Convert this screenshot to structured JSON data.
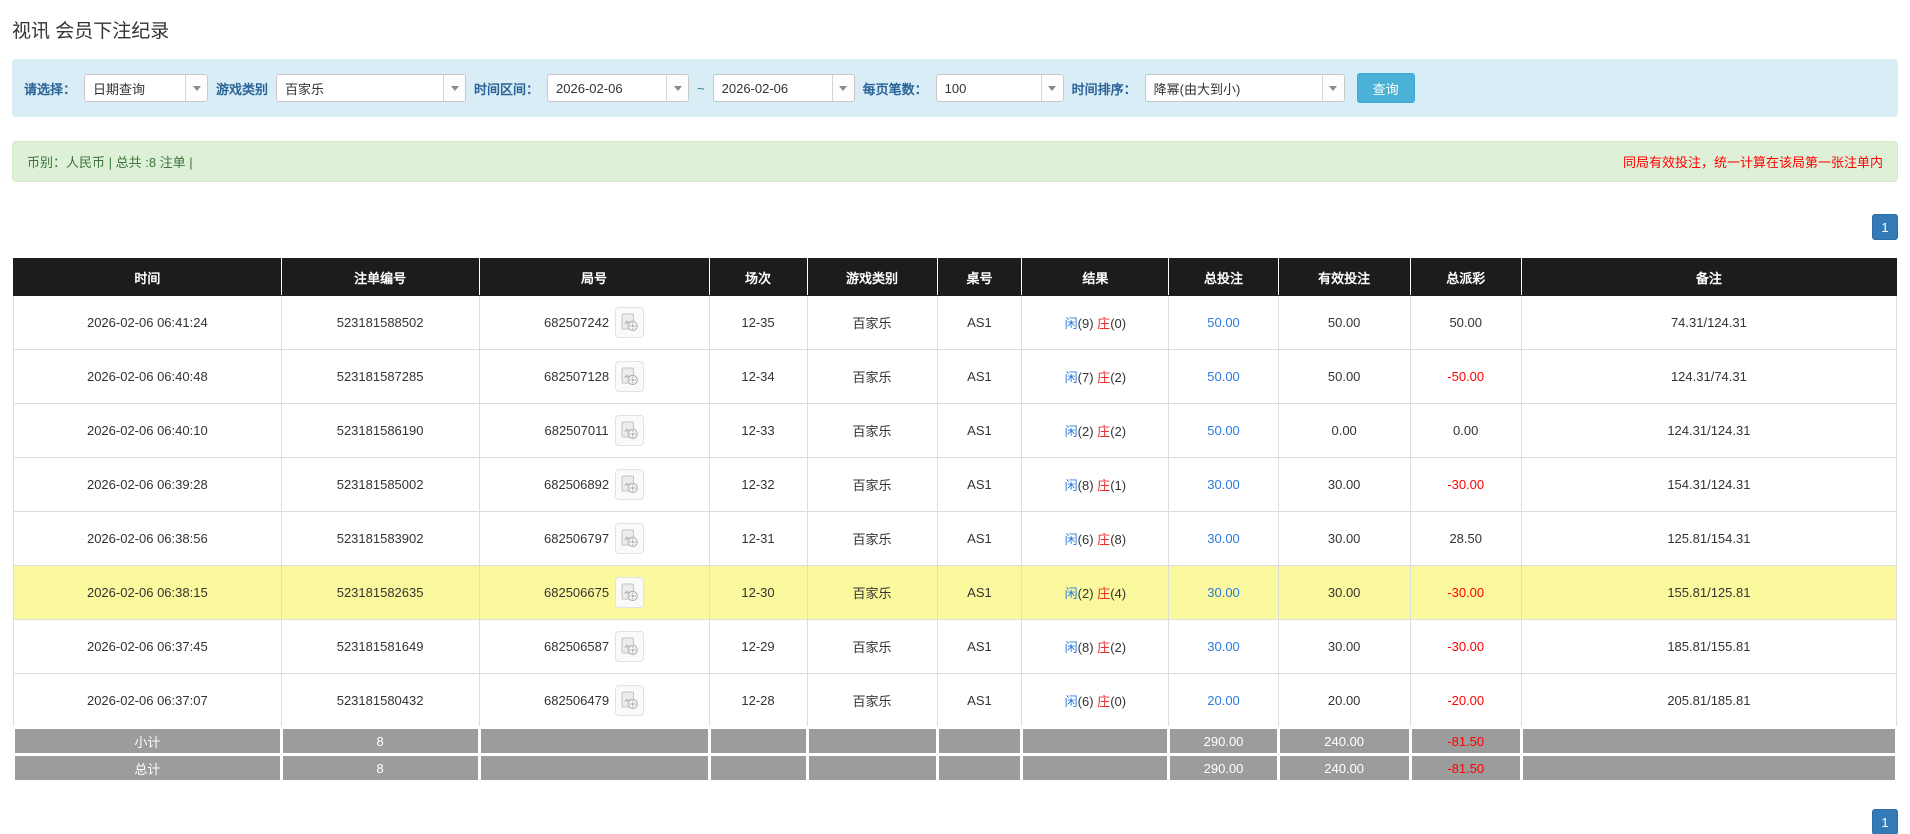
{
  "page": {
    "title": "视讯 会员下注纪录"
  },
  "filters": {
    "query_type": {
      "label": "请选择：",
      "value": "日期查询"
    },
    "game_type": {
      "label": "游戏类别",
      "value": "百家乐"
    },
    "time_range": {
      "label": "时间区间：",
      "from": "2026-02-06",
      "to": "2026-02-06",
      "separator": "~"
    },
    "page_size": {
      "label": "每页笔数：",
      "value": "100"
    },
    "time_sort": {
      "label": "时间排序：",
      "value": "降幂(由大到小)"
    },
    "search_label": "查询"
  },
  "info_bar": {
    "left": "币别：人民币 | 总共 :8 注单 |",
    "right": "同局有效投注，统一计算在该局第一张注单内"
  },
  "pagination": {
    "top": "1",
    "bottom": "1"
  },
  "table": {
    "headers": [
      "时间",
      "注单编号",
      "局号",
      "场次",
      "游戏类别",
      "桌号",
      "结果",
      "总投注",
      "有效投注",
      "总派彩",
      "备注"
    ],
    "video_icon": "video-replay-icon",
    "rows": [
      {
        "time": "2026-02-06 06:41:24",
        "bet_id": "523181588502",
        "round_id": "682507242",
        "session": "12-35",
        "game": "百家乐",
        "table_no": "AS1",
        "result": {
          "player": "闲",
          "player_score": "(9)",
          "banker": "庄",
          "banker_score": "(0)"
        },
        "total_bet": "50.00",
        "valid_bet": "50.00",
        "payout": "50.00",
        "remark": "74.31/124.31",
        "highlight": false
      },
      {
        "time": "2026-02-06 06:40:48",
        "bet_id": "523181587285",
        "round_id": "682507128",
        "session": "12-34",
        "game": "百家乐",
        "table_no": "AS1",
        "result": {
          "player": "闲",
          "player_score": "(7)",
          "banker": "庄",
          "banker_score": "(2)"
        },
        "total_bet": "50.00",
        "valid_bet": "50.00",
        "payout": "-50.00",
        "remark": "124.31/74.31",
        "highlight": false
      },
      {
        "time": "2026-02-06 06:40:10",
        "bet_id": "523181586190",
        "round_id": "682507011",
        "session": "12-33",
        "game": "百家乐",
        "table_no": "AS1",
        "result": {
          "player": "闲",
          "player_score": "(2)",
          "banker": "庄",
          "banker_score": "(2)"
        },
        "total_bet": "50.00",
        "valid_bet": "0.00",
        "payout": "0.00",
        "remark": "124.31/124.31",
        "highlight": false
      },
      {
        "time": "2026-02-06 06:39:28",
        "bet_id": "523181585002",
        "round_id": "682506892",
        "session": "12-32",
        "game": "百家乐",
        "table_no": "AS1",
        "result": {
          "player": "闲",
          "player_score": "(8)",
          "banker": "庄",
          "banker_score": "(1)"
        },
        "total_bet": "30.00",
        "valid_bet": "30.00",
        "payout": "-30.00",
        "remark": "154.31/124.31",
        "highlight": false
      },
      {
        "time": "2026-02-06 06:38:56",
        "bet_id": "523181583902",
        "round_id": "682506797",
        "session": "12-31",
        "game": "百家乐",
        "table_no": "AS1",
        "result": {
          "player": "闲",
          "player_score": "(6)",
          "banker": "庄",
          "banker_score": "(8)"
        },
        "total_bet": "30.00",
        "valid_bet": "30.00",
        "payout": "28.50",
        "remark": "125.81/154.31",
        "highlight": false
      },
      {
        "time": "2026-02-06 06:38:15",
        "bet_id": "523181582635",
        "round_id": "682506675",
        "session": "12-30",
        "game": "百家乐",
        "table_no": "AS1",
        "result": {
          "player": "闲",
          "player_score": "(2)",
          "banker": "庄",
          "banker_score": "(4)"
        },
        "total_bet": "30.00",
        "valid_bet": "30.00",
        "payout": "-30.00",
        "remark": "155.81/125.81",
        "highlight": true
      },
      {
        "time": "2026-02-06 06:37:45",
        "bet_id": "523181581649",
        "round_id": "682506587",
        "session": "12-29",
        "game": "百家乐",
        "table_no": "AS1",
        "result": {
          "player": "闲",
          "player_score": "(8)",
          "banker": "庄",
          "banker_score": "(2)"
        },
        "total_bet": "30.00",
        "valid_bet": "30.00",
        "payout": "-30.00",
        "remark": "185.81/155.81",
        "highlight": false
      },
      {
        "time": "2026-02-06 06:37:07",
        "bet_id": "523181580432",
        "round_id": "682506479",
        "session": "12-28",
        "game": "百家乐",
        "table_no": "AS1",
        "result": {
          "player": "闲",
          "player_score": "(6)",
          "banker": "庄",
          "banker_score": "(0)"
        },
        "total_bet": "20.00",
        "valid_bet": "20.00",
        "payout": "-20.00",
        "remark": "205.81/185.81",
        "highlight": false
      }
    ],
    "subtotal": {
      "label": "小计",
      "count": "8",
      "total_bet": "290.00",
      "valid_bet": "240.00",
      "payout": "-81.50"
    },
    "grand_total": {
      "label": "总计",
      "count": "8",
      "total_bet": "290.00",
      "valid_bet": "240.00",
      "payout": "-81.50"
    }
  },
  "colors": {
    "filter_bar_bg": "#d9edf7",
    "search_button": "#4bb1d6",
    "info_bar_bg": "#dff0d8",
    "info_green": "#3c763d",
    "warning_red": "#ff0000",
    "header_bg": "#1c1c1c",
    "total_row_bg": "#9c9c9c",
    "highlight_yellow": "#fbf99e",
    "link_blue": "#2d7bdd",
    "player_blue": "#2d7bdd",
    "banker_red": "#e82c2c",
    "pagination_blue": "#337ab7"
  }
}
